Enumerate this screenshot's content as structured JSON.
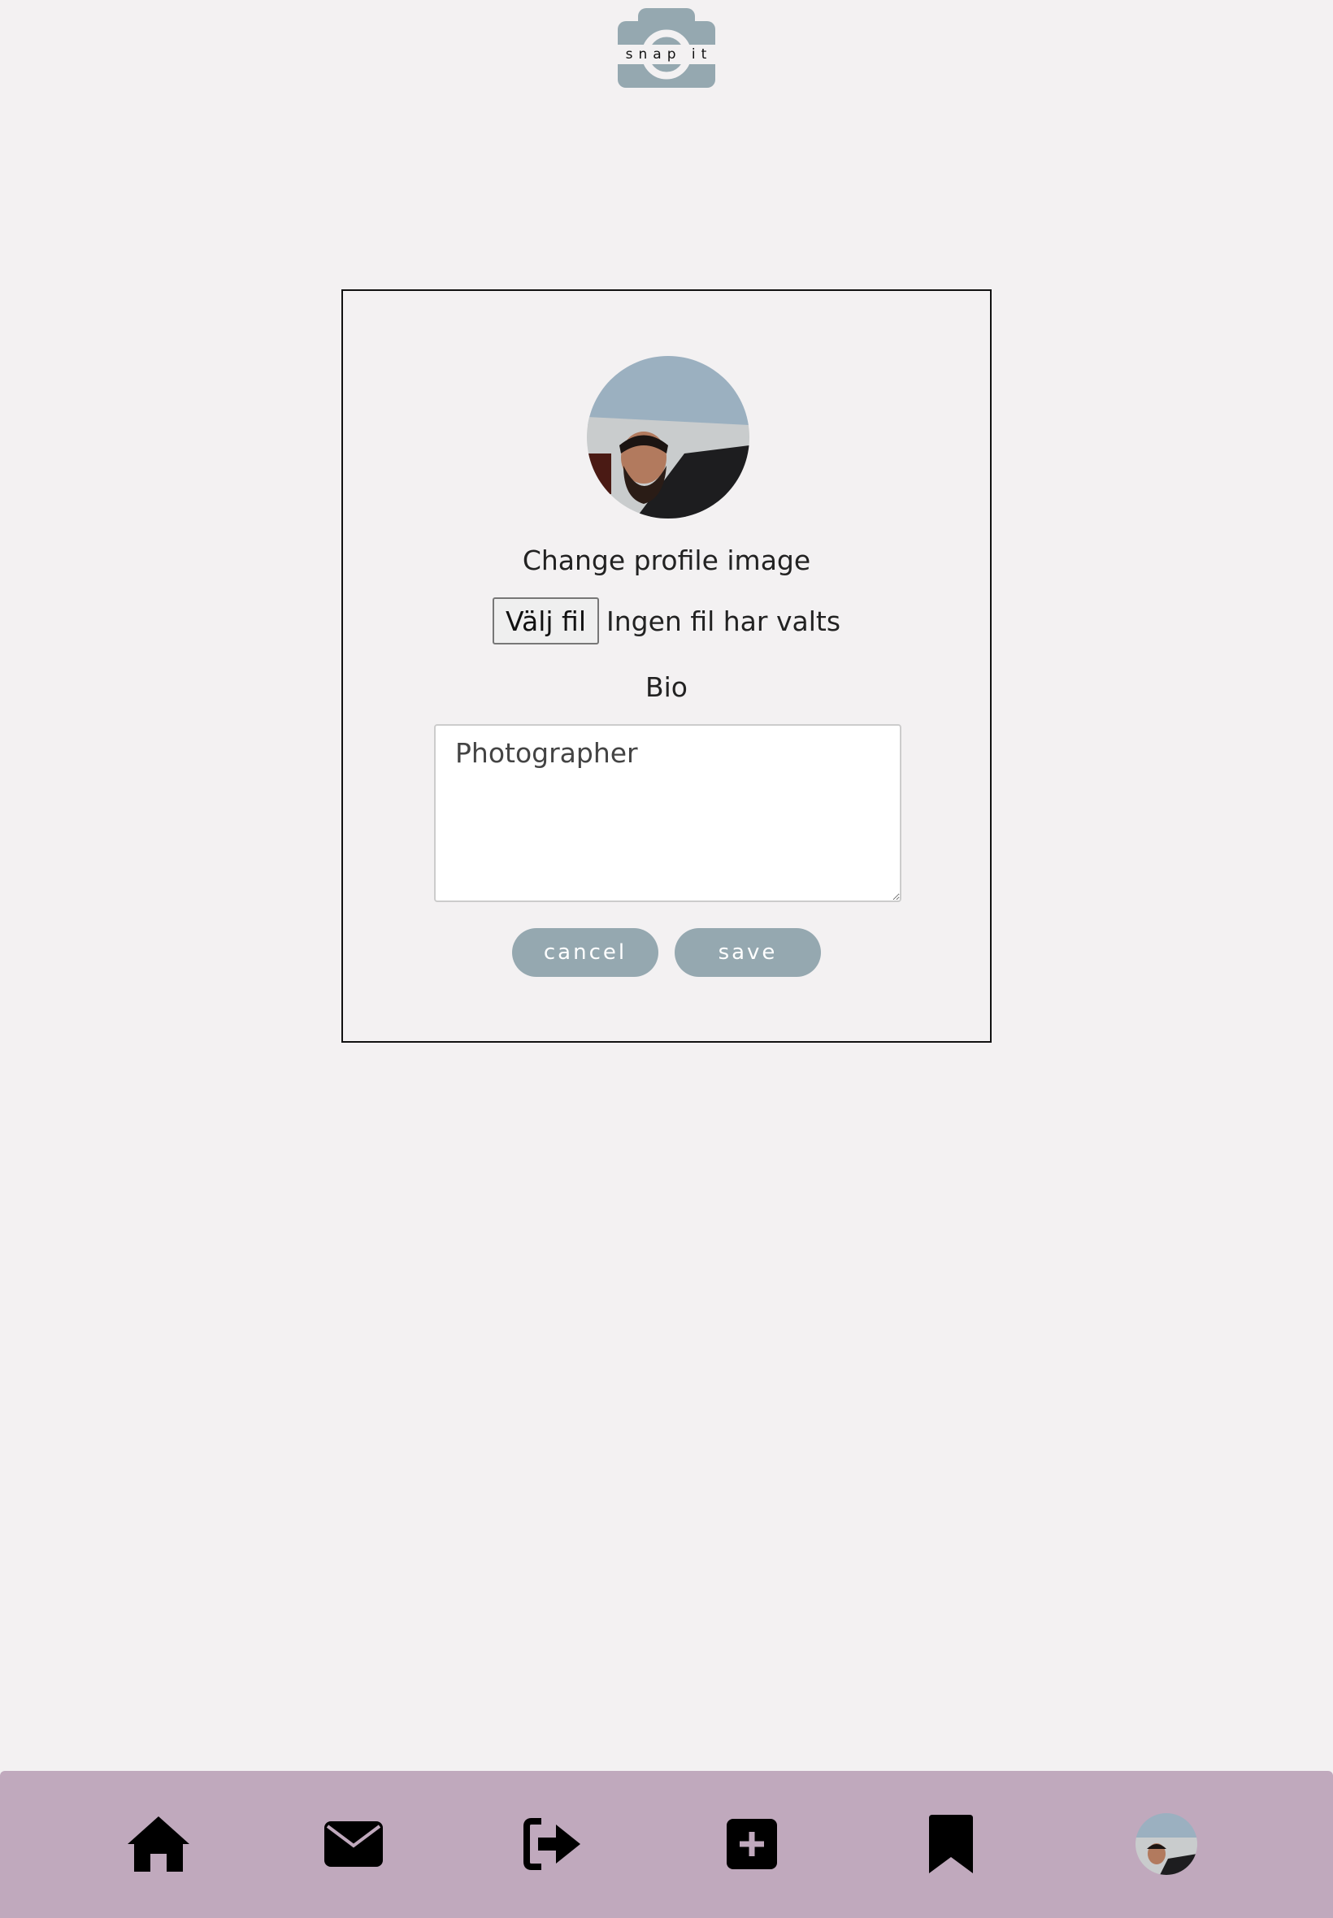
{
  "app": {
    "logo_text": "snap it"
  },
  "profile_form": {
    "change_image_label": "Change profile image",
    "file_button_label": "Välj fil",
    "file_status": "Ingen fil har valts",
    "bio_label": "Bio",
    "bio_value": "Photographer",
    "cancel_label": "cancel",
    "save_label": "save"
  },
  "nav": {
    "items": [
      "home-icon",
      "envelope-icon",
      "sign-out-icon",
      "plus-square-icon",
      "bookmark-icon",
      "profile-avatar"
    ]
  },
  "colors": {
    "background": "#f3f1f2",
    "nav": "#c0a9bd",
    "button": "#95a8b0",
    "logo": "#95a8b0"
  }
}
